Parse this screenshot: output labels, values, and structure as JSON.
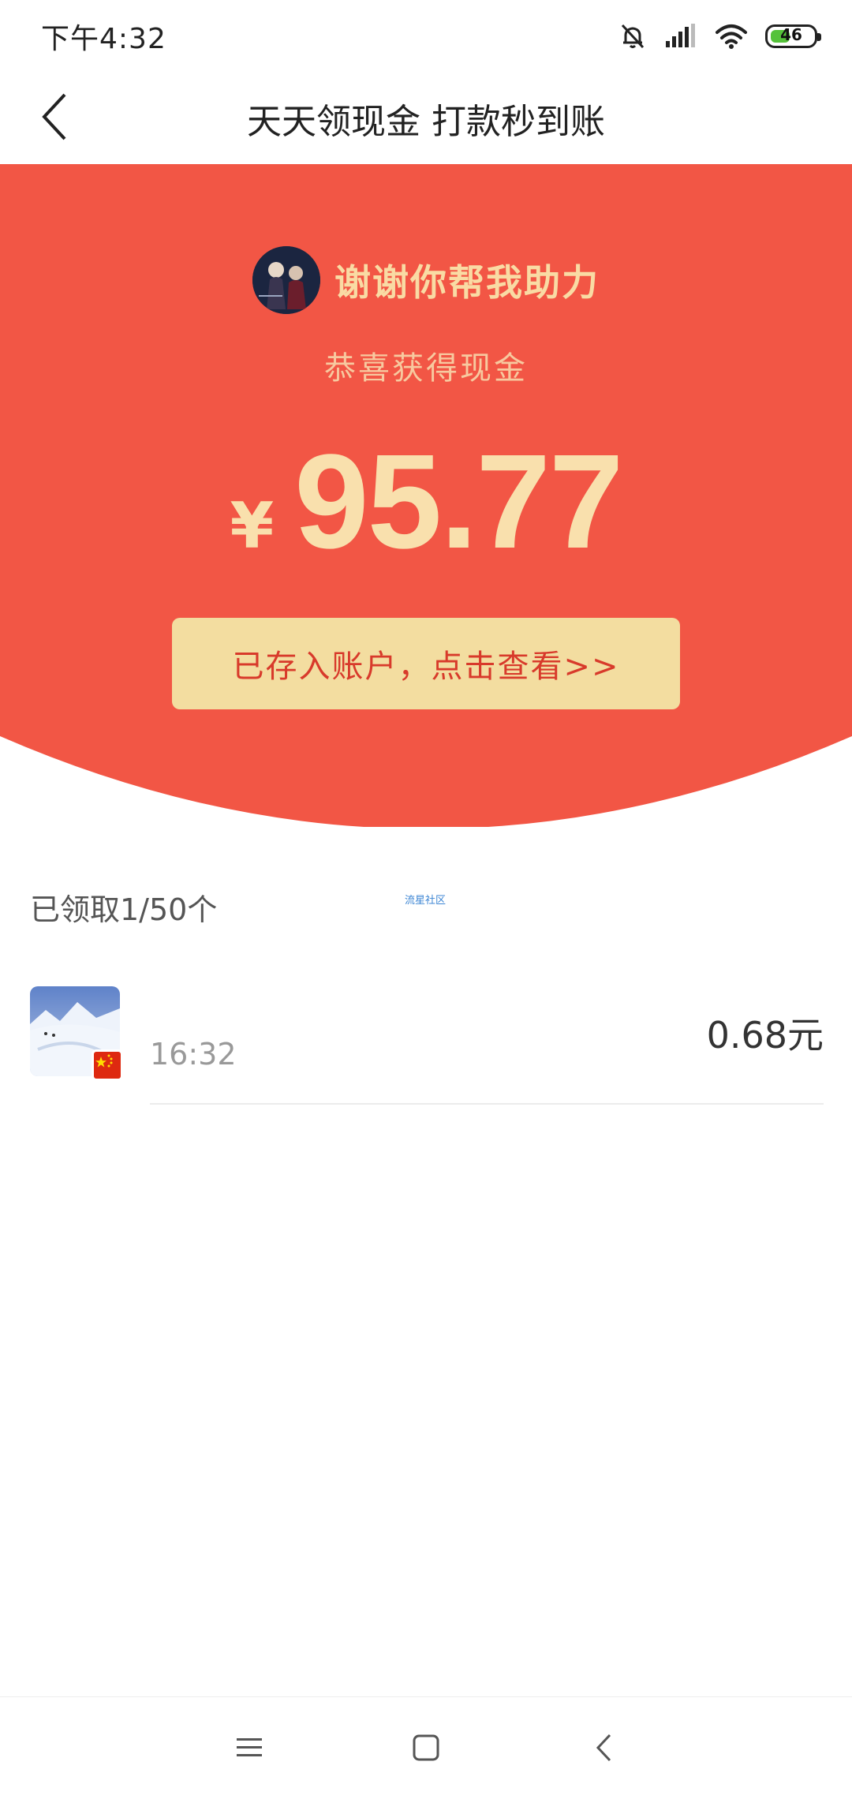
{
  "status_bar": {
    "time": "下午4:32",
    "battery_level": "46",
    "battery_fraction": 0.46,
    "battery_color": "#55c23a",
    "icons": [
      "mute-icon",
      "signal-icon",
      "wifi-icon",
      "battery-icon"
    ]
  },
  "nav": {
    "title": "天天领现金 打款秒到账",
    "back_icon": "chevron-left-icon"
  },
  "hero": {
    "background_color": "#f25645",
    "thanks_text": "谢谢你帮我助力",
    "subtitle": "恭喜获得现金",
    "currency_symbol": "¥",
    "amount": "95.77",
    "deposit_button_label": "已存入账户，点击查看>>"
  },
  "summary": {
    "received_count": "已领取1/50个",
    "watermark": "流星社区"
  },
  "records": [
    {
      "time": "16:32",
      "amount": "0.68元",
      "badge_icon": "china-flag-icon"
    }
  ],
  "system_nav": {
    "buttons": [
      "menu-icon",
      "home-icon",
      "back-icon"
    ]
  }
}
